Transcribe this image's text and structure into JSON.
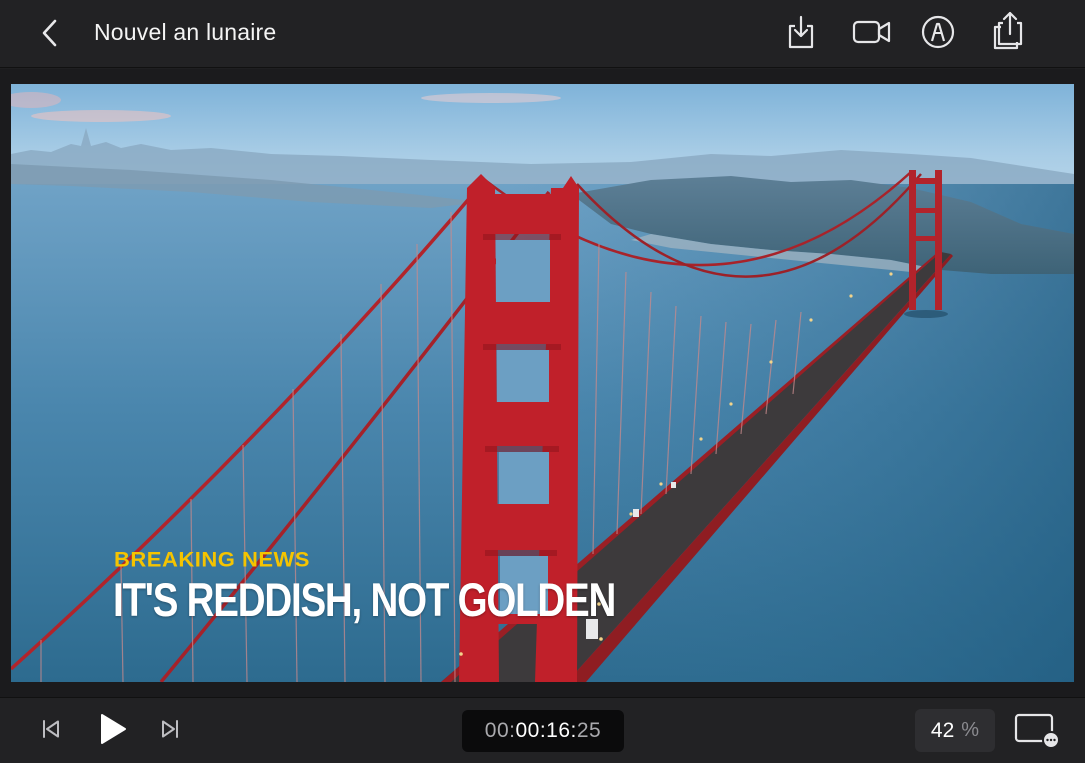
{
  "header": {
    "title": "Nouvel an lunaire",
    "icons": [
      "chevron-left-icon",
      "import-icon",
      "video-camera-icon",
      "markup-pen-icon",
      "share-icon"
    ]
  },
  "viewer": {
    "overlay": {
      "kicker": "BREAKING NEWS",
      "headline": "IT'S REDDISH, NOT GOLDEN"
    },
    "colors": {
      "bridge": "#c0202a",
      "kicker": "#f5c400",
      "water": "#3f7fa4",
      "sky": "#8fc0de"
    }
  },
  "transport": {
    "timecode_dim": "00:",
    "timecode_bright": "00:16:",
    "timecode_frames": "25",
    "zoom_value": "42",
    "zoom_unit": "%",
    "icons": [
      "skip-back-icon",
      "play-icon",
      "skip-forward-icon",
      "display-options-icon"
    ]
  }
}
